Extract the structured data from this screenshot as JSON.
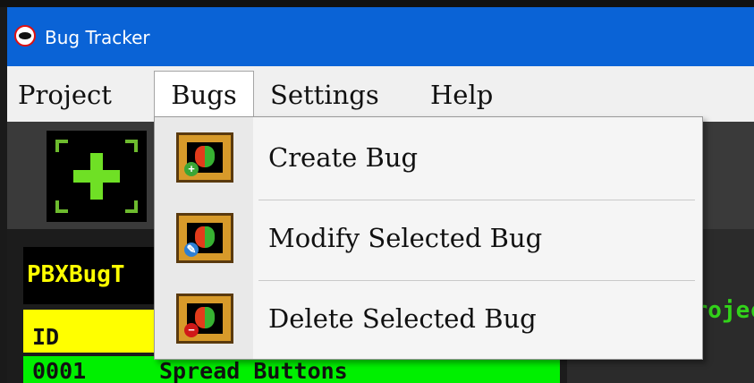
{
  "window": {
    "title": "Bug Tracker",
    "app_icon": "bug-tracker-icon"
  },
  "menubar": {
    "project": "Project",
    "bugs": "Bugs",
    "settings": "Settings",
    "help": "Help"
  },
  "toolbar": {
    "add_icon": "plus-icon"
  },
  "bugs_menu": {
    "items": [
      {
        "label": "Create Bug",
        "icon": "create-bug-icon"
      },
      {
        "label": "Modify Selected Bug",
        "icon": "modify-bug-icon"
      },
      {
        "label": "Delete Selected Bug",
        "icon": "delete-bug-icon"
      }
    ]
  },
  "project_panel": {
    "name": "PBXBugT",
    "right_label": "Projec"
  },
  "bug_table": {
    "header_id": "ID",
    "rows": [
      {
        "id": "0001",
        "title": "Spread Buttons"
      }
    ]
  },
  "colors": {
    "title_bar": "#0a63d6",
    "header_yellow": "#ffff00",
    "row_green": "#00f000",
    "accent_green": "#6fe025"
  }
}
